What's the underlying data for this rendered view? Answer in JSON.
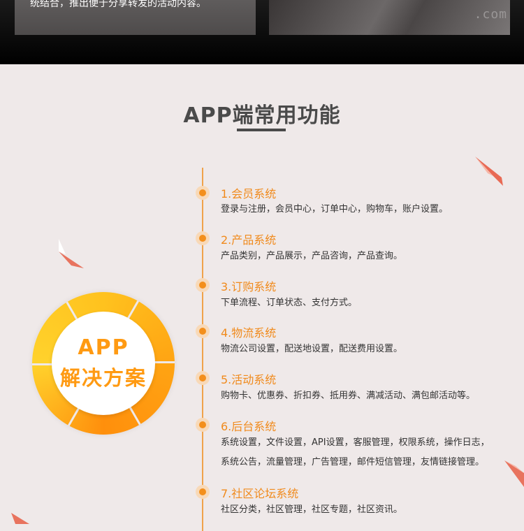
{
  "top_banner": {
    "left_text": "统结合，推出便于分享转发的活动内容。",
    "right_watermark": ".com"
  },
  "section": {
    "title": "APP端常用功能"
  },
  "badge": {
    "line1": "APP",
    "line2": "解决方案"
  },
  "colors": {
    "accent": "#f08a1c",
    "title": "#4a4a4a",
    "background": "#efe9e9"
  },
  "features": [
    {
      "title": "1.会员系统",
      "lines": [
        "登录与注册，会员中心，订单中心，购物车，账户设置。"
      ]
    },
    {
      "title": "2.产品系统",
      "lines": [
        "产品类别，产品展示，产品咨询，产品查询。"
      ]
    },
    {
      "title": "3.订购系统",
      "lines": [
        "下单流程、订单状态、支付方式。"
      ]
    },
    {
      "title": "4.物流系统",
      "lines": [
        "物流公司设置，配送地设置，配送费用设置。"
      ]
    },
    {
      "title": "5.活动系统",
      "lines": [
        "购物卡、优惠券、折扣券、抵用券、满减活动、满包邮活动等。"
      ]
    },
    {
      "title": "6.后台系统",
      "lines": [
        "系统设置，文件设置，API设置，客服管理，权限系统，操作日志，",
        "系统公告，流量管理，广告管理，邮件短信管理，友情链接管理。"
      ]
    },
    {
      "title": "7.社区论坛系统",
      "lines": [
        "社区分类，社区管理，社区专题，社区资讯。"
      ]
    }
  ]
}
